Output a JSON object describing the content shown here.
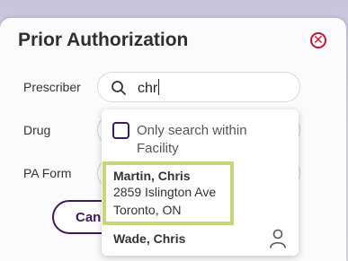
{
  "modal": {
    "title": "Prior Authorization",
    "close_icon": "close-circle-icon"
  },
  "form": {
    "prescriber_label": "Prescriber",
    "drug_label": "Drug",
    "pa_form_label": "PA Form",
    "search_value": "chr",
    "search_icon": "search-icon"
  },
  "buttons": {
    "cancel_label": "Can"
  },
  "dropdown": {
    "checkbox_label": "Only search within Facility",
    "checkbox_checked": false,
    "results": [
      {
        "name": "Martin, Chris",
        "address": "2859 Islington Ave",
        "city": "Toronto, ON",
        "highlighted": true
      },
      {
        "name": "Wade, Chris",
        "icon": "person-icon"
      }
    ]
  },
  "colors": {
    "accent": "#3d1a5c",
    "close": "#c0182f",
    "highlight": "#c3d87a"
  }
}
